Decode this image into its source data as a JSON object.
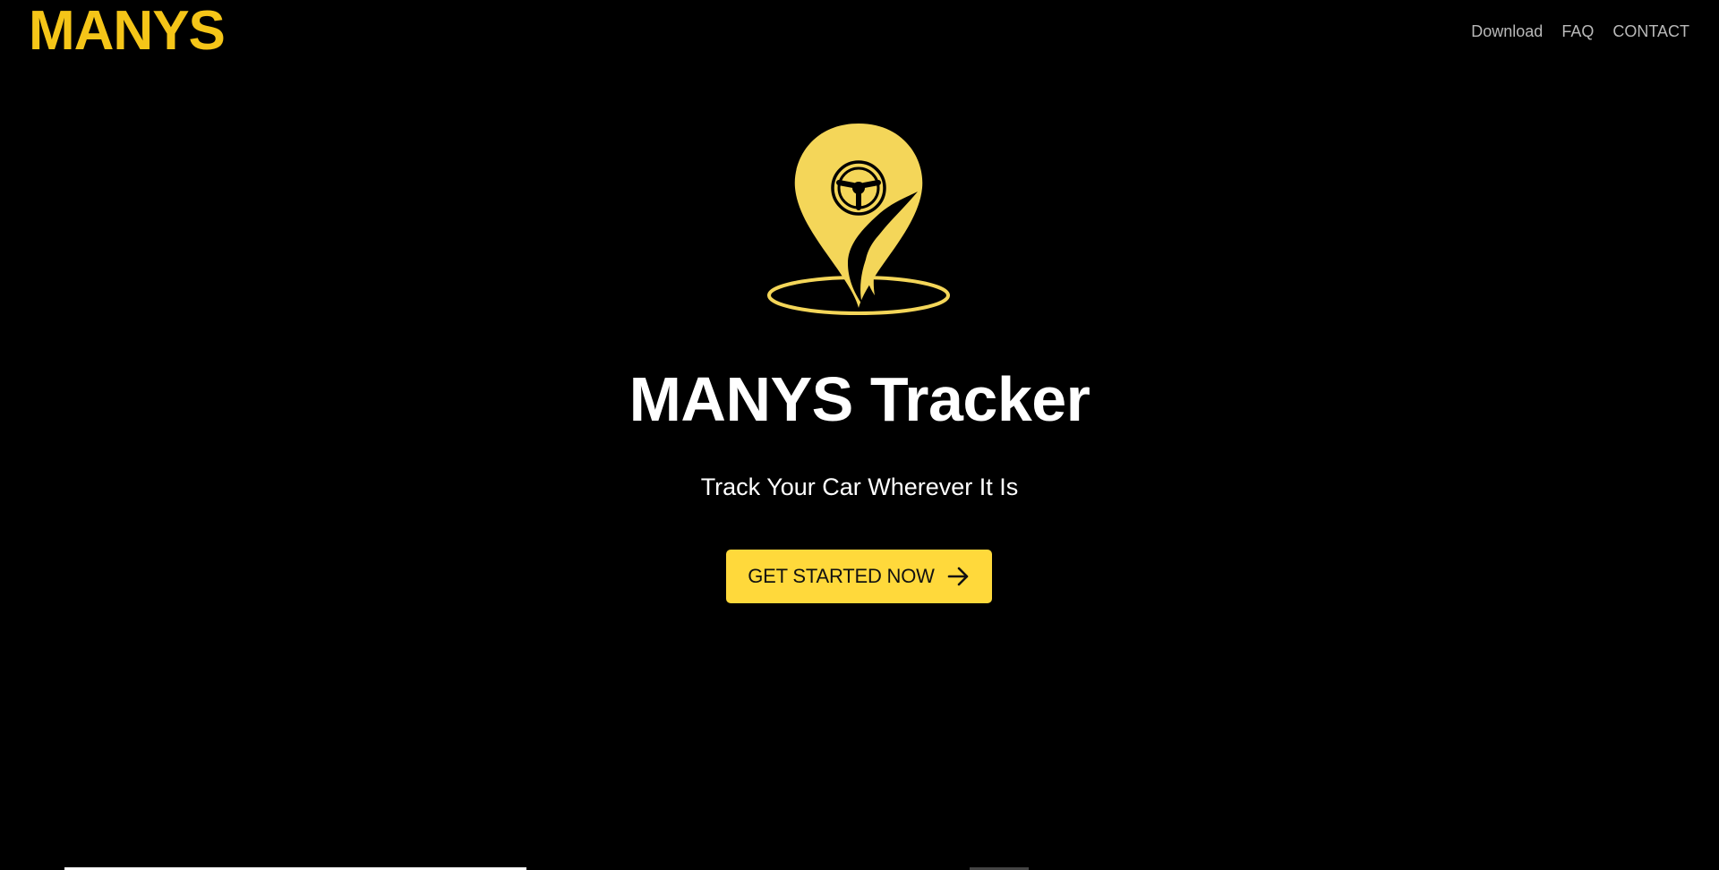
{
  "header": {
    "brand": "MANYS",
    "nav": [
      {
        "label": "Download"
      },
      {
        "label": "FAQ"
      },
      {
        "label": "CONTACT"
      }
    ]
  },
  "hero": {
    "logo_icon": "location-pin-steering-wheel-icon",
    "title": "MANYS Tracker",
    "subtitle": "Track Your Car Wherever It Is",
    "cta_label": "GET STARTED NOW",
    "cta_icon": "arrow-right-icon"
  },
  "colors": {
    "background": "#000000",
    "brand_yellow": "#F5C518",
    "logo_yellow": "#F4D659",
    "button_yellow": "#FFD93B",
    "nav_text": "#b9b9b9",
    "title_text": "#ffffff"
  }
}
